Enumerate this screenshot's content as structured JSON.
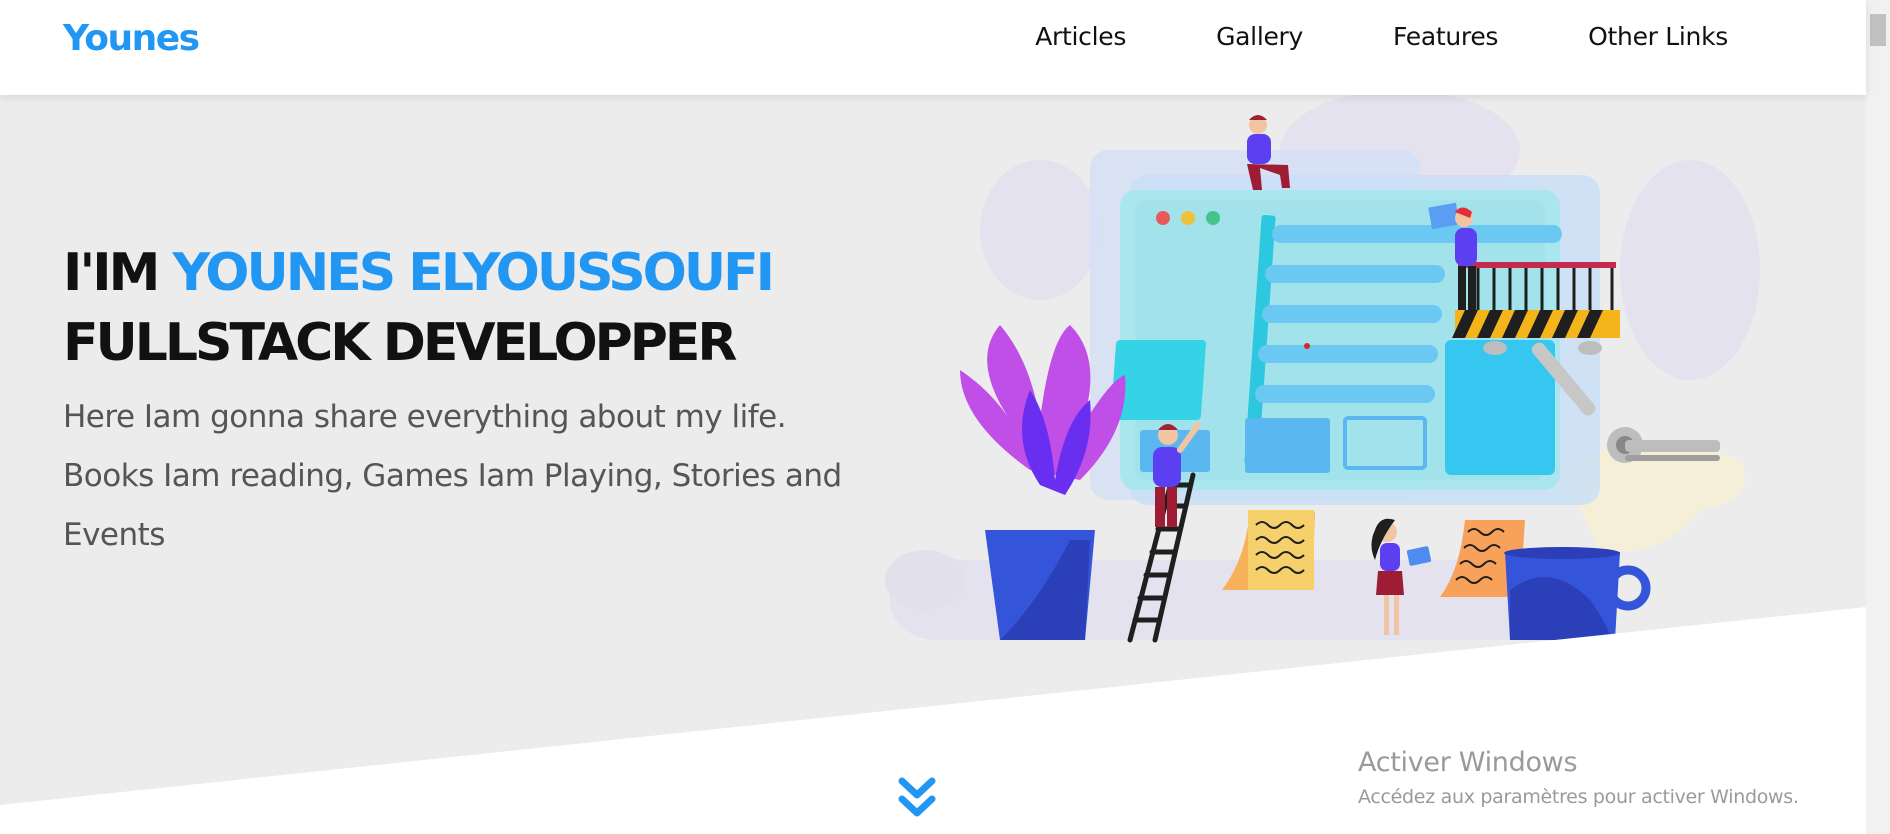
{
  "header": {
    "logo": "Younes",
    "nav": [
      "Articles",
      "Gallery",
      "Features",
      "Other Links"
    ]
  },
  "hero": {
    "title_prefix": "I'IM ",
    "title_highlight": "YOUNES ELYOUSSOUFI",
    "title_line2": "FULLSTACK DEVELOPPER",
    "desc_line1": "Here Iam gonna share everything about my life.",
    "desc_line2": "Books Iam reading, Games Iam Playing, Stories and",
    "desc_line3": "Events"
  },
  "watermark": {
    "title": "Activer Windows",
    "subtitle": "Accédez aux paramètres pour activer Windows."
  },
  "icons": {
    "scroll_down": "angle-double-down-icon"
  },
  "colors": {
    "accent": "#2196f3",
    "landing_bg": "#ececec",
    "heading": "#111111",
    "body_text": "#555555"
  }
}
